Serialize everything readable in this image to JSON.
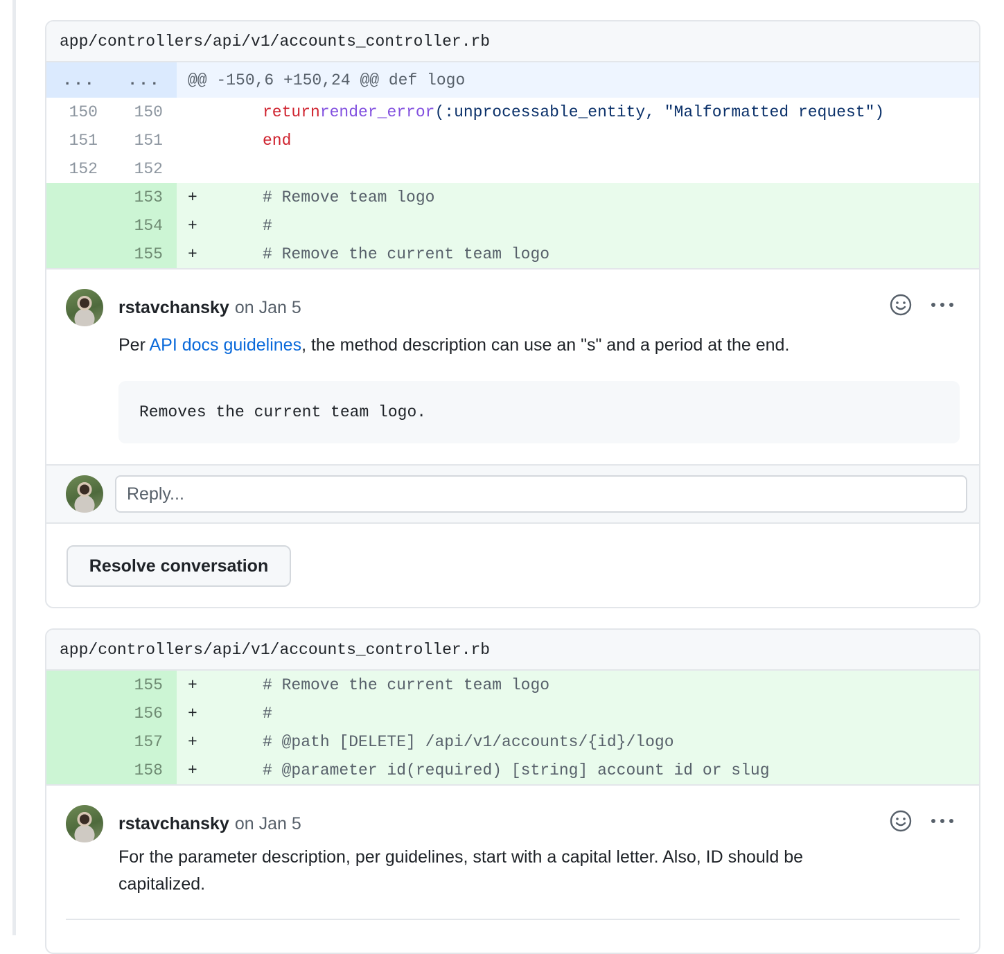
{
  "threads": [
    {
      "file_path": "app/controllers/api/v1/accounts_controller.rb",
      "hunk": {
        "old_marker": "...",
        "new_marker": "...",
        "text": "@@ -150,6 +150,24 @@ def logo"
      },
      "lines": [
        {
          "old": "150",
          "new": "150",
          "marker": "",
          "code": "return render_error(:unprocessable_entity, \"Malformatted request\")"
        },
        {
          "old": "151",
          "new": "151",
          "marker": "",
          "code": "end"
        },
        {
          "old": "152",
          "new": "152",
          "marker": "",
          "code": ""
        },
        {
          "old": "",
          "new": "153",
          "marker": "+",
          "code": "# Remove team logo"
        },
        {
          "old": "",
          "new": "154",
          "marker": "+",
          "code": "#"
        },
        {
          "old": "",
          "new": "155",
          "marker": "+",
          "code": "# Remove the current team logo"
        }
      ],
      "comment": {
        "author": "rstavchansky",
        "when": "on Jan 5",
        "body_prefix": "Per ",
        "link_text": "API docs guidelines",
        "body_suffix": ", the method description can use an \"s\" and a period at the end.",
        "code_quote": "Removes the current team logo."
      },
      "reply_placeholder": "Reply...",
      "resolve_label": "Resolve conversation"
    },
    {
      "file_path": "app/controllers/api/v1/accounts_controller.rb",
      "lines": [
        {
          "old": "",
          "new": "155",
          "marker": "+",
          "code": "# Remove the current team logo"
        },
        {
          "old": "",
          "new": "156",
          "marker": "+",
          "code": "#"
        },
        {
          "old": "",
          "new": "157",
          "marker": "+",
          "code": "# @path [DELETE] /api/v1/accounts/{id}/logo"
        },
        {
          "old": "",
          "new": "158",
          "marker": "+",
          "code": "# @parameter id(required) [string] account id or slug"
        }
      ],
      "comment": {
        "author": "rstavchansky",
        "when": "on Jan 5",
        "body_line1": "For the parameter description, per guidelines, start with a capital letter. Also, ID should be",
        "body_line2": "capitalized."
      }
    }
  ],
  "icons": {
    "reaction": "smiley-icon",
    "more": "kebab-horizontal-icon"
  },
  "colors": {
    "added_bg": "#e9fbec",
    "added_gutter": "#ccf5d4",
    "hunk_bg": "#eef5ff",
    "link": "#0969da",
    "keyword": "#cf222e",
    "function": "#8250df"
  }
}
